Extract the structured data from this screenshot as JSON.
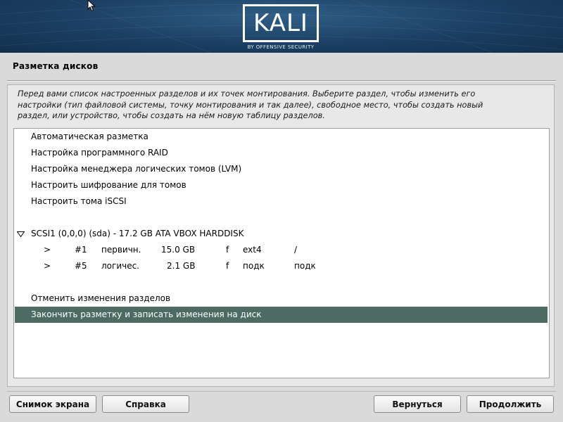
{
  "banner": {
    "logo_text": "KALI",
    "logo_subtitle": "BY OFFENSIVE SECURITY",
    "colors": {
      "banner_dark": "#12304d",
      "banner_light": "#2f5e86"
    }
  },
  "page": {
    "title": "Разметка дисков",
    "description": [
      "Перед вами список настроенных разделов и их точек монтирования. Выберите раздел, чтобы изменить его",
      "настройки (тип файловой системы, точку монтирования и так далее), свободное место, чтобы создать новый",
      "раздел, или устройство, чтобы создать на нём новую таблицу разделов."
    ]
  },
  "list": {
    "actions": [
      "Автоматическая разметка",
      "Настройка программного RAID",
      "Настройка менеджера логических томов (LVM)",
      "Настроить шифрование для томов",
      "Настроить тома iSCSI"
    ],
    "disk": {
      "icon": "expand-triangle-icon",
      "label": "SCSI1 (0,0,0) (sda) - 17.2 GB ATA VBOX HARDDISK"
    },
    "partitions": [
      {
        "arrow": ">",
        "number": "#1",
        "type": "первичн.",
        "size": "15.0 GB",
        "flag": "f",
        "fs": "ext4",
        "mount": "/"
      },
      {
        "arrow": ">",
        "number": "#5",
        "type": "логичес.",
        "size": "2.1 GB",
        "flag": "f",
        "fs": "подк",
        "mount": "подк"
      }
    ],
    "undo": "Отменить изменения разделов",
    "finish": "Закончить разметку и записать изменения на диск",
    "selected_item": "finish",
    "colors": {
      "selection": "#4d6b63"
    }
  },
  "buttons": {
    "screenshot": "Снимок экрана",
    "help": "Справка",
    "back": "Вернуться",
    "continue": "Продолжить"
  }
}
